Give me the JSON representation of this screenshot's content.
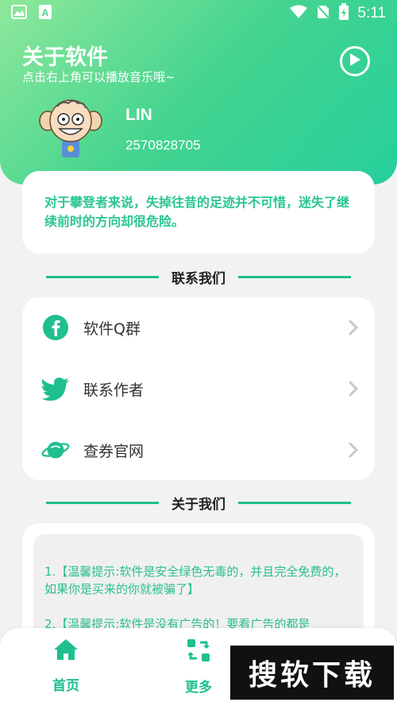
{
  "status_bar": {
    "time": "5:11"
  },
  "header": {
    "title": "关于软件",
    "subtitle": "点击右上角可以播放音乐哦~"
  },
  "user": {
    "name": "LIN",
    "qq": "2570828705"
  },
  "quote": {
    "text": "对于攀登者来说，失掉往昔的足迹并不可惜，迷失了继续前时的方向却很危险。"
  },
  "sections": {
    "contact_title": "联系我们",
    "about_title": "关于我们"
  },
  "contact_items": [
    {
      "label": "软件Q群",
      "icon": "facebook-icon"
    },
    {
      "label": "联系作者",
      "icon": "twitter-icon"
    },
    {
      "label": "查券官网",
      "icon": "planet-icon"
    }
  ],
  "about": {
    "items": [
      "1.【温馨提示:软件是安全绿色无毒的，并且完全免费的，如果你是买来的你就被骗了】",
      "2.【温馨提示:软件是没有广告的！要看广告的都是"
    ]
  },
  "bottom_nav": {
    "items": [
      {
        "label": "首页",
        "icon": "home-icon"
      },
      {
        "label": "更多",
        "icon": "refresh-icon"
      }
    ]
  },
  "watermark": {
    "text": "搜软下载"
  },
  "colors": {
    "accent": "#1fbf8f",
    "header_start": "#8ee89b",
    "header_end": "#26cf9c",
    "quote_text": "#29c593"
  }
}
